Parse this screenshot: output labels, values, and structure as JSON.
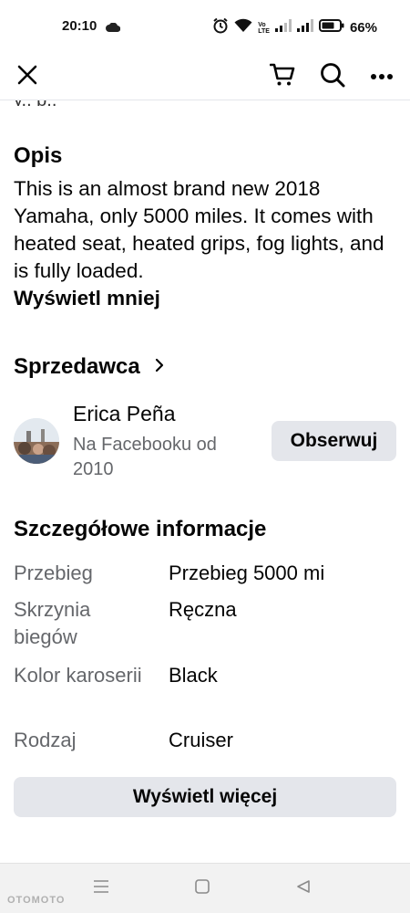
{
  "status_bar": {
    "time": "20:10",
    "network_label_top": "Vo",
    "network_label_mid": "LTE",
    "battery": "66%"
  },
  "top_bar": {
    "icons": [
      "close-icon",
      "cart-icon",
      "search-icon",
      "more-icon"
    ]
  },
  "clipped_previous_text": "y.. p..",
  "description": {
    "title": "Opis",
    "text": "This is an almost brand new 2018 Yamaha, only 5000 miles. It comes with heated seat, heated grips, fog lights, and is fully loaded.",
    "toggle": "Wyświetl mniej"
  },
  "seller": {
    "title": "Sprzedawca",
    "name": "Erica Peña",
    "since": "Na Facebooku od 2010",
    "follow": "Obserwuj"
  },
  "details": {
    "title": "Szczegółowe informacje",
    "rows": [
      {
        "label": "Przebieg",
        "value": "Przebieg 5000 mi"
      },
      {
        "label": "Skrzynia biegów",
        "value": "Ręczna"
      },
      {
        "label": "Kolor karoserii",
        "value": "Black"
      },
      {
        "label": "Rodzaj",
        "value": "Cruiser"
      }
    ],
    "more": "Wyświetl więcej"
  },
  "watermark": "OTOMOTO",
  "colors": {
    "text": "#050505",
    "secondary": "#65676b",
    "button_bg": "#e4e6eb"
  }
}
